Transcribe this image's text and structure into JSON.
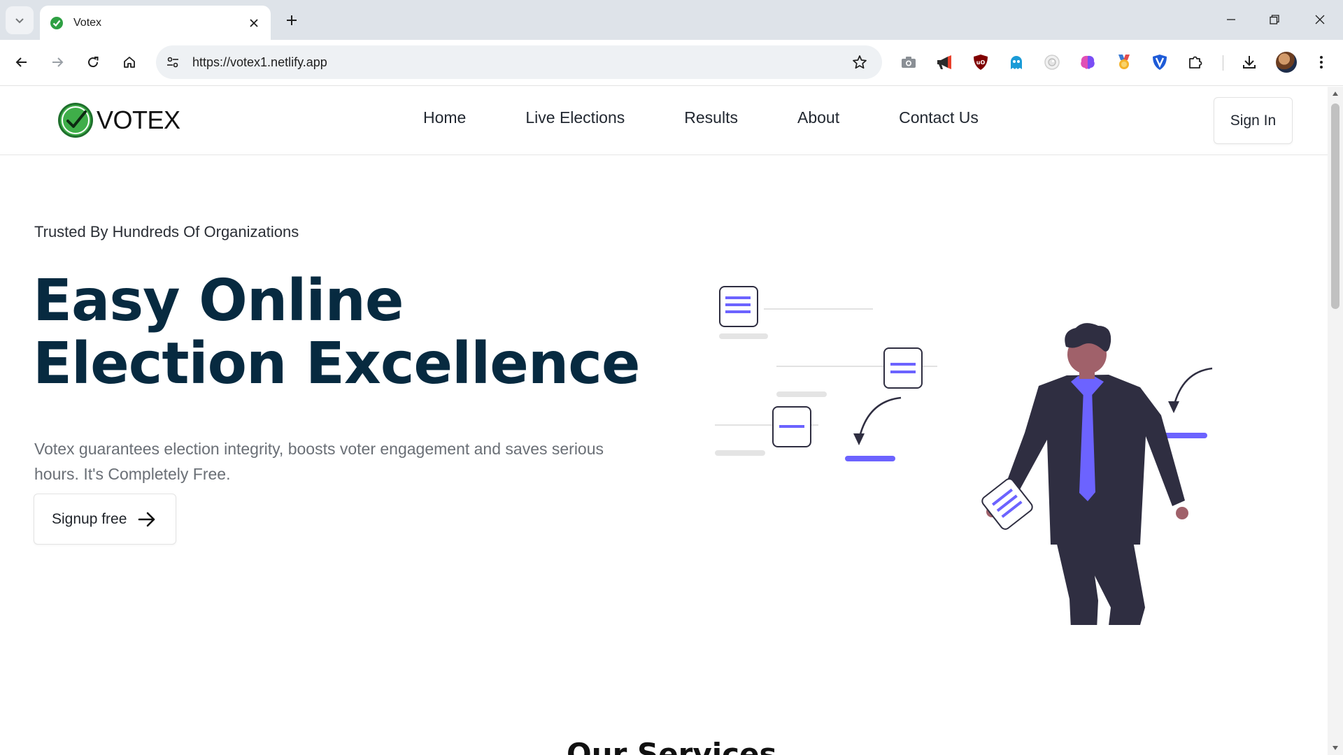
{
  "browser": {
    "tab": {
      "title": "Votex"
    },
    "address_bar": {
      "url": "https://votex1.netlify.app"
    },
    "icons": {
      "tab_search": "chevron-down-icon",
      "close_tab": "close-icon",
      "new_tab": "plus-icon",
      "back": "arrow-left-icon",
      "forward": "arrow-right-icon",
      "reload": "reload-icon",
      "home": "home-icon",
      "site_info": "tune-icon",
      "bookmark": "star-icon",
      "extensions": [
        "camera-icon",
        "megaphone-icon",
        "ublock-shield-icon",
        "ghost-icon",
        "eye-icon",
        "brain-icon",
        "medal-icon",
        "shield-v-icon",
        "puzzle-icon"
      ],
      "download": "download-icon",
      "menu": "kebab-menu-icon",
      "minimize": "minimize-icon",
      "maximize": "restore-icon",
      "close_window": "close-icon"
    }
  },
  "site": {
    "brand": {
      "name": "VOTEX",
      "logo_color": "#2ea043"
    },
    "nav": [
      "Home",
      "Live Elections",
      "Results",
      "About",
      "Contact Us"
    ],
    "sign_in": "Sign In",
    "hero": {
      "tagline": "Trusted By Hundreds Of Organizations",
      "title_line1": "Easy Online",
      "title_line2": "Election Excellence",
      "description": "Votex guarantees election integrity, boosts voter engagement and saves serious hours. It's Completely Free.",
      "cta": "Signup free"
    },
    "next_section_heading": "Our Services",
    "colors": {
      "heading": "#072a40",
      "accent": "#6c63ff",
      "suit": "#2f2e41"
    }
  }
}
